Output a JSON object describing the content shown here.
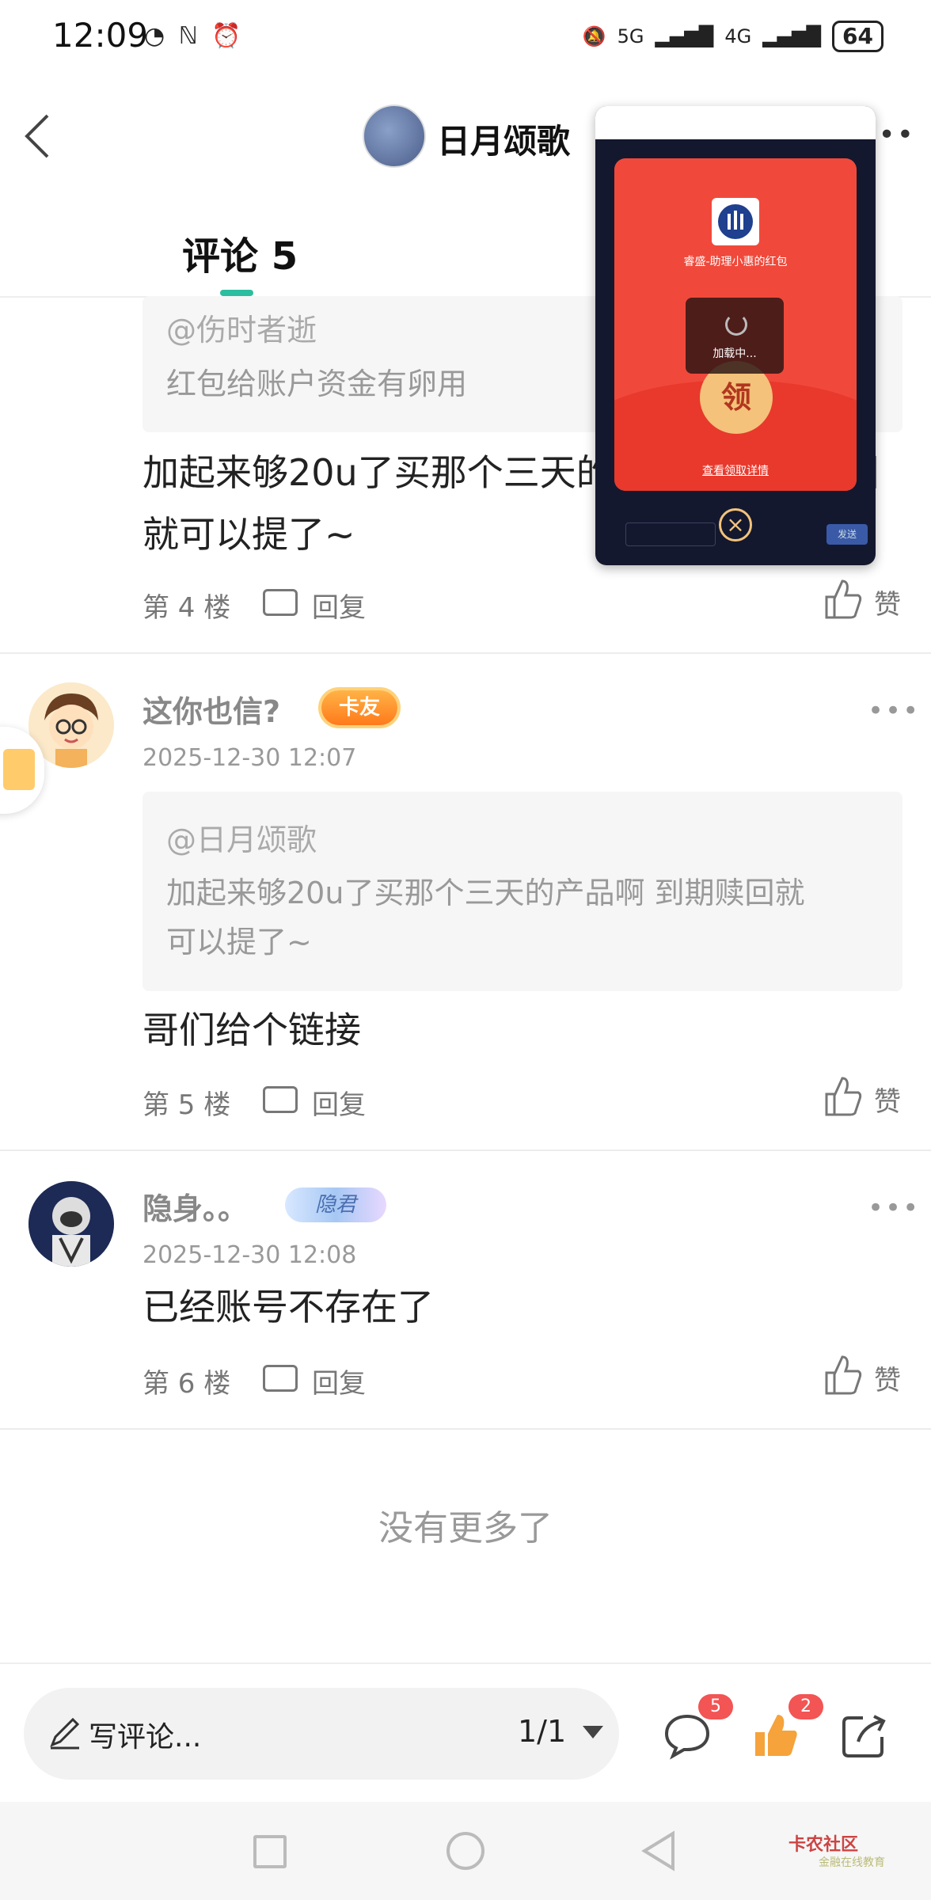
{
  "status_bar": {
    "time": "12:09",
    "battery": "64",
    "signal1": "5G",
    "signal2": "4G"
  },
  "header": {
    "title": "日月颂歌",
    "tab_label": "评论 5"
  },
  "overlay": {
    "packet_name": "睿盛-助理小惠的红包",
    "loading": "加载中...",
    "open_label": "领",
    "details_link": "查看领取详情",
    "send_label": "发送"
  },
  "comments": [
    {
      "quote_user": "@伤时者逝",
      "quote_text": "红包给账户资金有卵用",
      "body_line1": "加起来够20u了买那个三天的产品啊 到期赎回",
      "body_line2": "就可以提了~",
      "floor": "第 4 楼",
      "reply": "回复",
      "like": "赞"
    },
    {
      "username": "这你也信?",
      "badge": "卡友",
      "date": "2025-12-30 12:07",
      "quote_user": "@日月颂歌",
      "quote_line1": "加起来够20u了买那个三天的产品啊 到期赎回就",
      "quote_line2": "可以提了~",
      "body": "哥们给个链接",
      "floor": "第 5 楼",
      "reply": "回复",
      "like": "赞"
    },
    {
      "username": "隐身。。",
      "badge": "隐君",
      "date": "2025-12-30 12:08",
      "body": "已经账号不存在了",
      "floor": "第 6 楼",
      "reply": "回复",
      "like": "赞"
    }
  ],
  "no_more": "没有更多了",
  "bottom_bar": {
    "input_label": "写评论...",
    "pager": "1/1",
    "comment_count": "5",
    "like_count": "2"
  },
  "watermark": {
    "brand": "卡农社区",
    "sub": "金融在线教育"
  },
  "colors": {
    "accent": "#2bbd9f",
    "badge_red": "#f35454",
    "packet_red": "#f0493b",
    "like_orange": "#f5a33a"
  }
}
